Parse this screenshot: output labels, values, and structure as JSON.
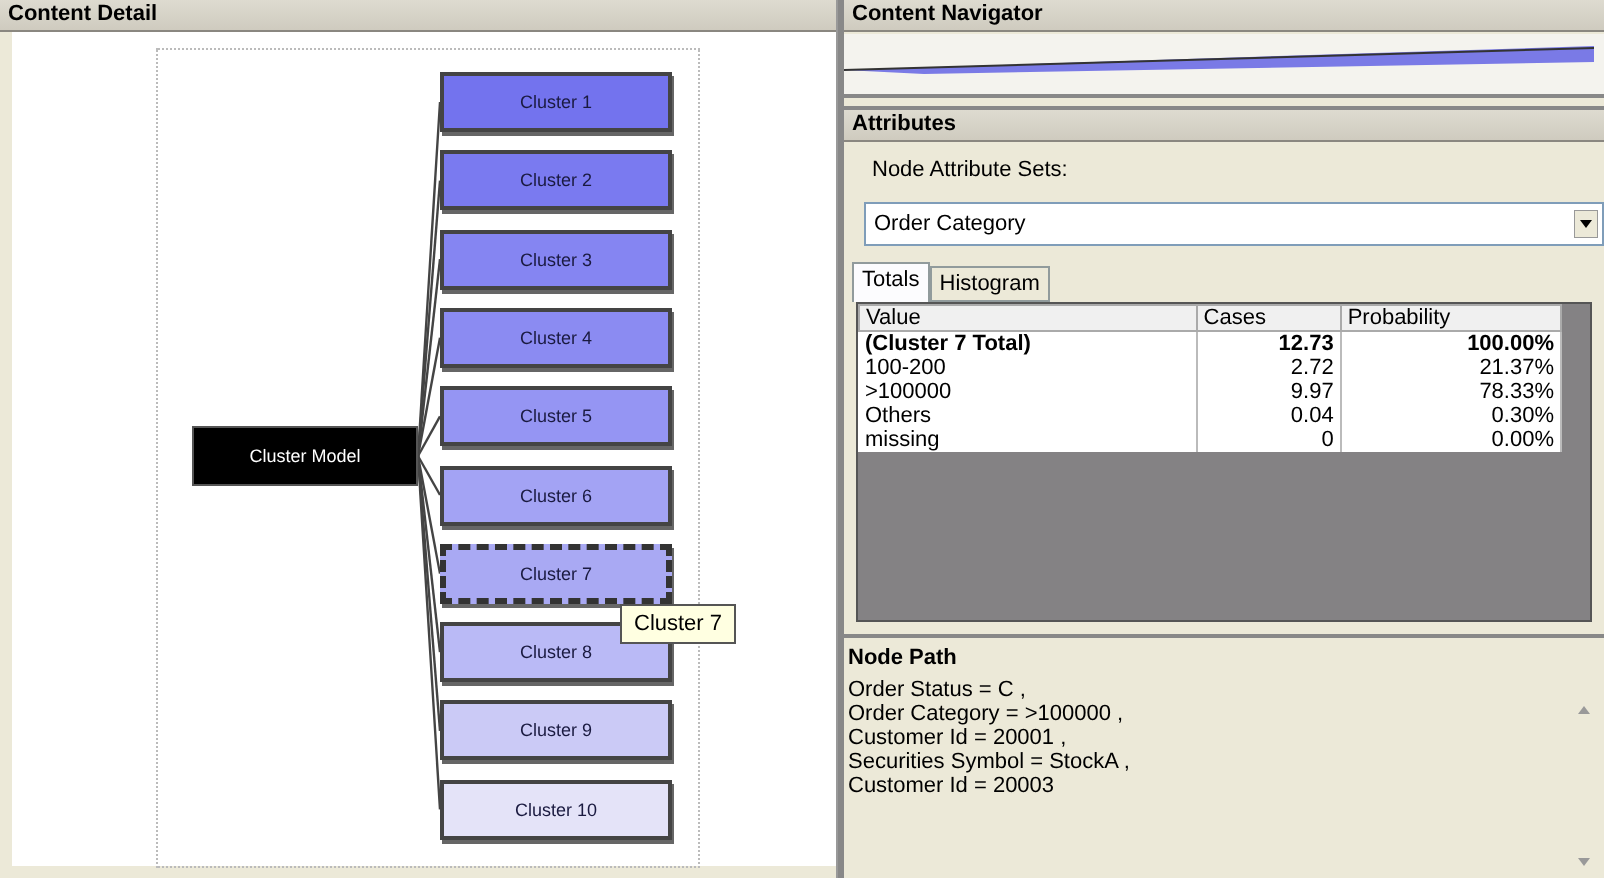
{
  "content_detail": {
    "title": "Content Detail",
    "model_node": {
      "label": "Cluster Model"
    },
    "clusters": [
      {
        "label": "Cluster 1",
        "color": "#7373ee",
        "selected": false
      },
      {
        "label": "Cluster 2",
        "color": "#7a7af0",
        "selected": false
      },
      {
        "label": "Cluster 3",
        "color": "#8585f2",
        "selected": false
      },
      {
        "label": "Cluster 4",
        "color": "#8b8bf2",
        "selected": false
      },
      {
        "label": "Cluster 5",
        "color": "#9595f3",
        "selected": false
      },
      {
        "label": "Cluster 6",
        "color": "#a3a3f4",
        "selected": false
      },
      {
        "label": "Cluster 7",
        "color": "#a9a9f3",
        "selected": true
      },
      {
        "label": "Cluster 8",
        "color": "#babaf6",
        "selected": false
      },
      {
        "label": "Cluster 9",
        "color": "#cbcaf6",
        "selected": false
      },
      {
        "label": "Cluster 10",
        "color": "#e4e3f8",
        "selected": false
      }
    ],
    "tooltip": "Cluster 7"
  },
  "content_navigator": {
    "title": "Content Navigator"
  },
  "attributes": {
    "title": "Attributes",
    "sets_label": "Node Attribute Sets:",
    "sets_value": "Order Category",
    "tabs": [
      {
        "label": "Totals",
        "selected": true
      },
      {
        "label": "Histogram",
        "selected": false
      }
    ],
    "table": {
      "columns": [
        "Value",
        "Cases",
        "Probability"
      ],
      "rows": [
        {
          "kind": "total",
          "cells": [
            "(Cluster 7 Total)",
            "12.73",
            "100.00%"
          ]
        },
        {
          "kind": "value",
          "cells": [
            "100-200",
            "2.72",
            "21.37%"
          ]
        },
        {
          "kind": "value",
          "cells": [
            ">100000",
            "9.97",
            "78.33%"
          ]
        },
        {
          "kind": "value",
          "cells": [
            "Others",
            "0.04",
            "0.30%"
          ]
        },
        {
          "kind": "value",
          "cells": [
            "missing",
            "0",
            "0.00%"
          ]
        }
      ]
    }
  },
  "node_path": {
    "title": "Node Path",
    "lines": [
      "Order Status = C ,",
      "Order Category = >100000 ,",
      "Customer Id = 20001 ,",
      "Securities Symbol = StockA ,",
      "Customer Id = 20003"
    ]
  }
}
